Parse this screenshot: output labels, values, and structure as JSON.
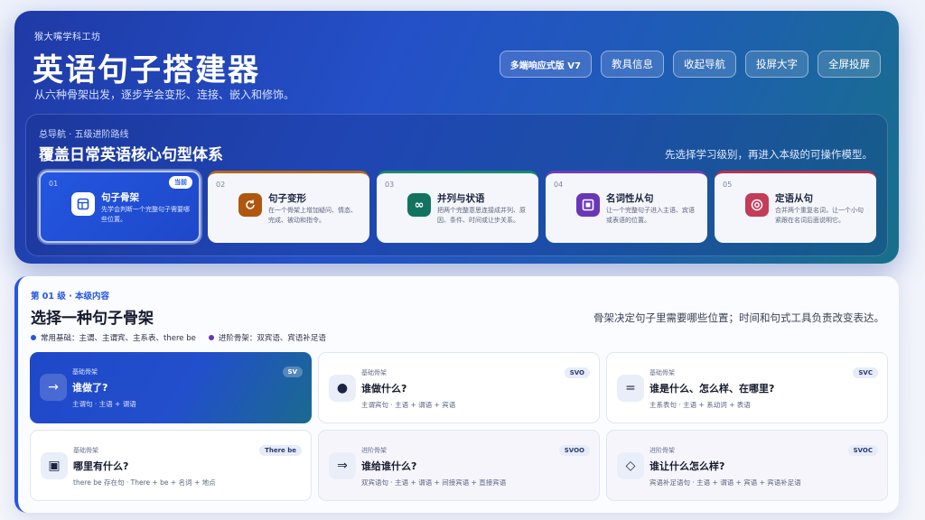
{
  "header": {
    "brand": "猴大嘴学科工坊",
    "title": "英语句子搭建器",
    "subtitle": "从六种骨架出发，逐步学会变形、连接、嵌入和修饰。",
    "actions": {
      "version": "多端响应式版 V7",
      "teacher_info": "教具信息",
      "collapse_nav": "收起导航",
      "big_text": "投屏大字",
      "fullscreen": "全屏投屏"
    }
  },
  "nav": {
    "kicker": "总导航 · 五级进阶路线",
    "title": "覆盖日常英语核心句型体系",
    "hint": "先选择学习级别，再进入本级的可操作模型。",
    "current_badge": "当前",
    "levels": [
      {
        "num": "01",
        "icon": "grid-icon",
        "name": "句子骨架",
        "desc": "先学会判断一个完整句子需要哪些位置。"
      },
      {
        "num": "02",
        "icon": "rotate-icon",
        "name": "句子变形",
        "desc": "在一个骨架上增加疑问、情态、完成、被动和指令。"
      },
      {
        "num": "03",
        "icon": "infinity-icon",
        "name": "并列与状语",
        "desc": "把两个完整意思连接成并列、原因、条件、时间或让步关系。"
      },
      {
        "num": "04",
        "icon": "square-icon",
        "name": "名词性从句",
        "desc": "让一个完整句子进入主语、宾语或表语的位置。"
      },
      {
        "num": "05",
        "icon": "target-icon",
        "name": "定语从句",
        "desc": "合并两个重复名词，让一个小句紧跟在名词后面说明它。"
      }
    ]
  },
  "content": {
    "kicker": "第 01 级 · 本级内容",
    "title": "选择一种句子骨架",
    "hint": "骨架决定句子里需要哪些位置；时间和句式工具负责改变表达。",
    "legend": [
      {
        "label": "常用基础：主谓、主谓宾、主系表、there be",
        "color": "#2456e0"
      },
      {
        "label": "进阶骨架：双宾语、宾语补足语",
        "color": "#6a36b8"
      }
    ],
    "cards": [
      {
        "kind": "基础骨架",
        "icon": "arrow-right-icon",
        "glyph": "→",
        "question": "谁做了?",
        "formula": "主谓句 · 主语 + 谓语",
        "tag": "SV"
      },
      {
        "kind": "基础骨架",
        "icon": "dot-icon",
        "glyph": "●",
        "question": "谁做什么?",
        "formula": "主谓宾句 · 主语 + 谓语 + 宾语",
        "tag": "SVO"
      },
      {
        "kind": "基础骨架",
        "icon": "equals-icon",
        "glyph": "=",
        "question": "谁是什么、怎么样、在哪里?",
        "formula": "主系表句 · 主语 + 系动词 + 表语",
        "tag": "SVC"
      },
      {
        "kind": "基础骨架",
        "icon": "box-icon",
        "glyph": "▣",
        "question": "哪里有什么?",
        "formula": "there be 存在句 · There + be + 名词 + 地点",
        "tag": "There be"
      },
      {
        "kind": "进阶骨架",
        "icon": "double-arrow-icon",
        "glyph": "⇒",
        "question": "谁给谁什么?",
        "formula": "双宾语句 · 主语 + 谓语 + 间接宾语 + 直接宾语",
        "tag": "SVOO"
      },
      {
        "kind": "进阶骨架",
        "icon": "diamond-icon",
        "glyph": "◇",
        "question": "谁让什么怎么样?",
        "formula": "宾语补足语句 · 主语 + 谓语 + 宾语 + 宾语补足语",
        "tag": "SVOC"
      }
    ]
  }
}
